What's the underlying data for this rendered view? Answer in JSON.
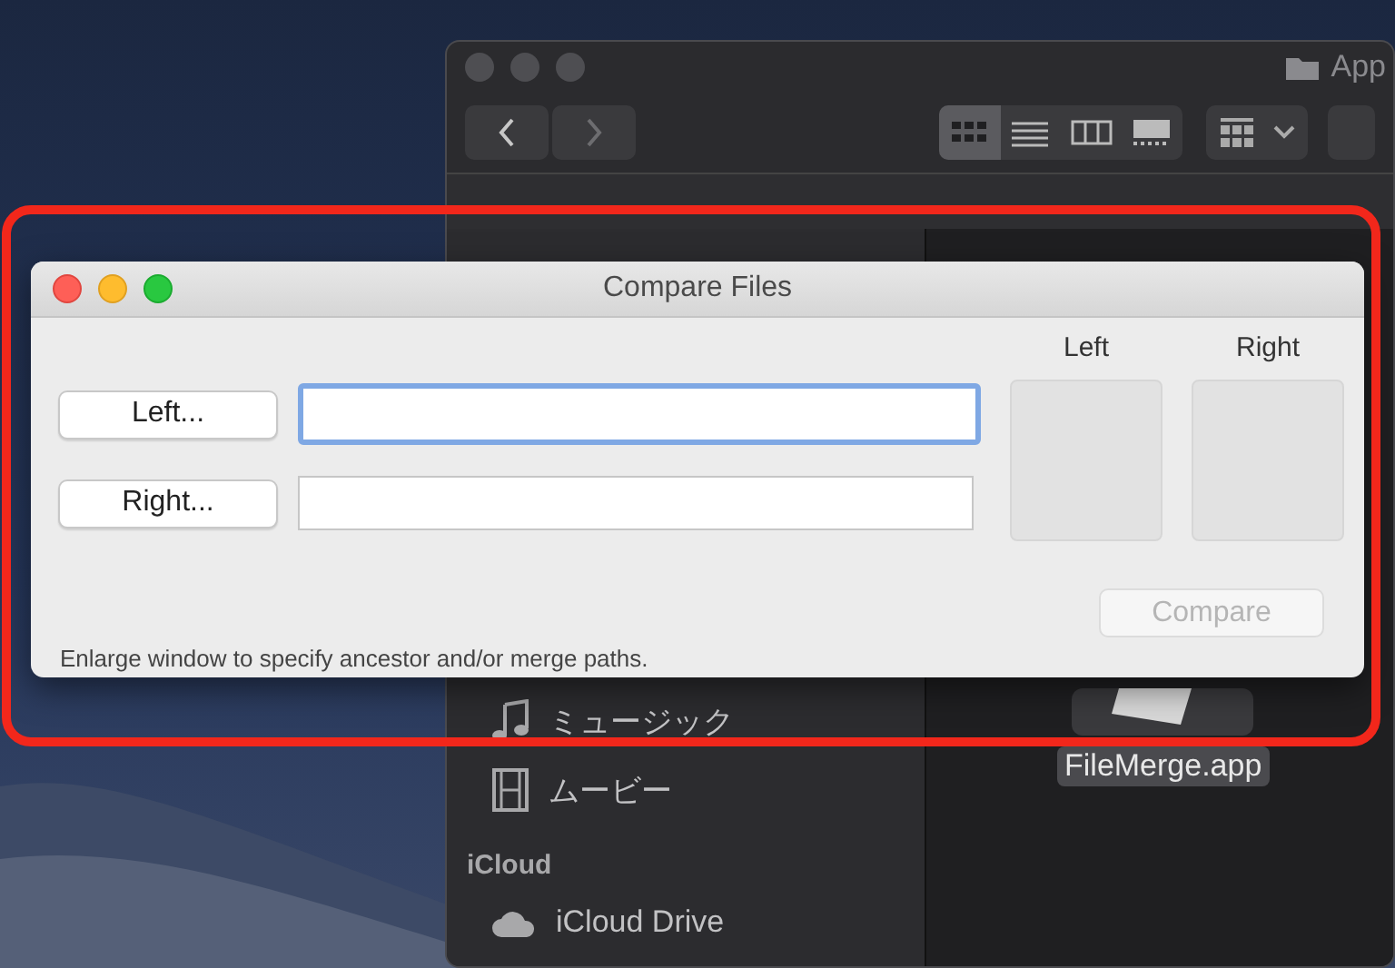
{
  "finder": {
    "title": "App",
    "view_modes": [
      {
        "kind": "icons",
        "selected": true
      },
      {
        "kind": "list",
        "selected": false
      },
      {
        "kind": "columns",
        "selected": false
      },
      {
        "kind": "gallery",
        "selected": false
      }
    ],
    "sidebar": {
      "items": [
        {
          "label": "ミュージック",
          "kind": "music"
        },
        {
          "label": "ムービー",
          "kind": "movies"
        }
      ],
      "sections": [
        {
          "header": "iCloud",
          "items": [
            {
              "label": "iCloud Drive",
              "kind": "cloud"
            }
          ]
        }
      ]
    },
    "files": [
      {
        "name": "FileMerge.app",
        "selected": true
      }
    ]
  },
  "dialog": {
    "title": "Compare Files",
    "rows": [
      {
        "button": "Left...",
        "focused": true
      },
      {
        "button": "Right...",
        "focused": false
      }
    ],
    "wells": [
      {
        "label": "Left"
      },
      {
        "label": "Right"
      }
    ],
    "compare_button": {
      "label": "Compare",
      "disabled": true
    },
    "hint": "Enlarge window to specify ancestor and/or merge paths."
  }
}
